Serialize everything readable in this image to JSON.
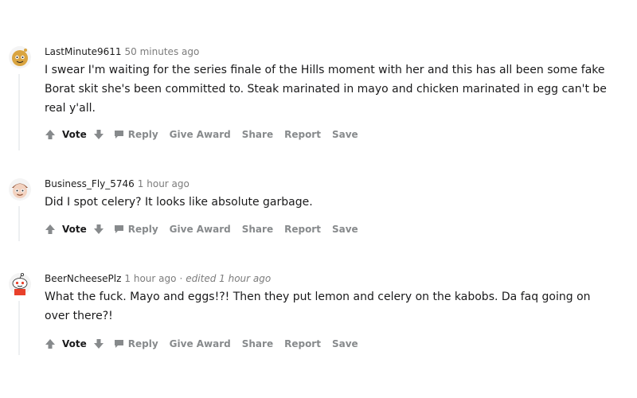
{
  "comments": [
    {
      "username": "LastMinute9611",
      "time": "50 minutes ago",
      "edited": "",
      "avatar_icon": "snoo-avatar-yellow",
      "text": "I swear I'm waiting for the series finale of the Hills moment with her and this has all been some fake Borat skit she's been committed to. Steak marinated in mayo and chicken marinated in egg can't be real y'all."
    },
    {
      "username": "Business_Fly_5746",
      "time": "1 hour ago",
      "edited": "",
      "avatar_icon": "snoo-avatar-brown",
      "text": "Did I spot celery? It looks like absolute garbage."
    },
    {
      "username": "BeerNcheesePlz",
      "time": "1 hour ago",
      "edited": "edited 1 hour ago",
      "avatar_icon": "snoo-avatar-red",
      "text": "What the fuck. Mayo and eggs!?! Then they put lemon and celery on the kabobs. Da faq going on over there?!"
    }
  ],
  "actions": {
    "vote": "Vote",
    "reply": "Reply",
    "give_award": "Give Award",
    "share": "Share",
    "report": "Report",
    "save": "Save"
  },
  "icons": {
    "upvote": "upvote-arrow-icon",
    "downvote": "downvote-arrow-icon",
    "reply": "comment-bubble-icon"
  },
  "colors": {
    "meta_gray": "#7c7c7c",
    "action_gray": "#878a8c",
    "thread_line": "#edeff1"
  }
}
